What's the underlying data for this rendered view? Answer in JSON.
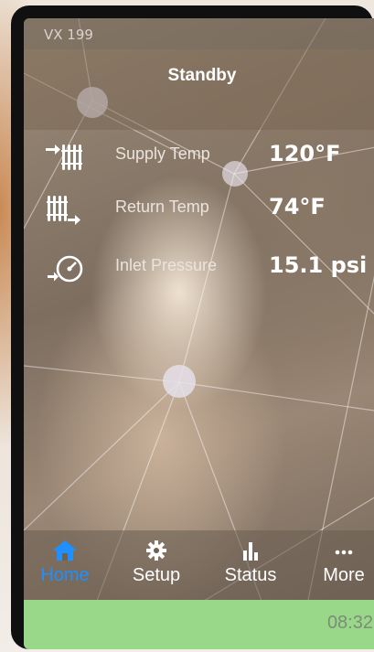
{
  "device": {
    "model": "VX 199"
  },
  "status": {
    "state": "Standby"
  },
  "readings": [
    {
      "icon": "supply-radiator-icon",
      "label": "Supply Temp",
      "value": "120°F"
    },
    {
      "icon": "return-radiator-icon",
      "label": "Return Temp",
      "value": "74°F"
    },
    {
      "icon": "pressure-gauge-icon",
      "label": "Inlet Pressure",
      "value": "15.1 psi"
    }
  ],
  "nav": {
    "active": "Home",
    "items": [
      {
        "icon": "home-icon",
        "label": "Home"
      },
      {
        "icon": "gear-icon",
        "label": "Setup"
      },
      {
        "icon": "bar-chart-icon",
        "label": "Status"
      },
      {
        "icon": "more-icon",
        "label": "More"
      }
    ]
  },
  "footer": {
    "clock": "08:32"
  },
  "colors": {
    "accent": "#1e90ff",
    "status_bar": "#99d888"
  }
}
